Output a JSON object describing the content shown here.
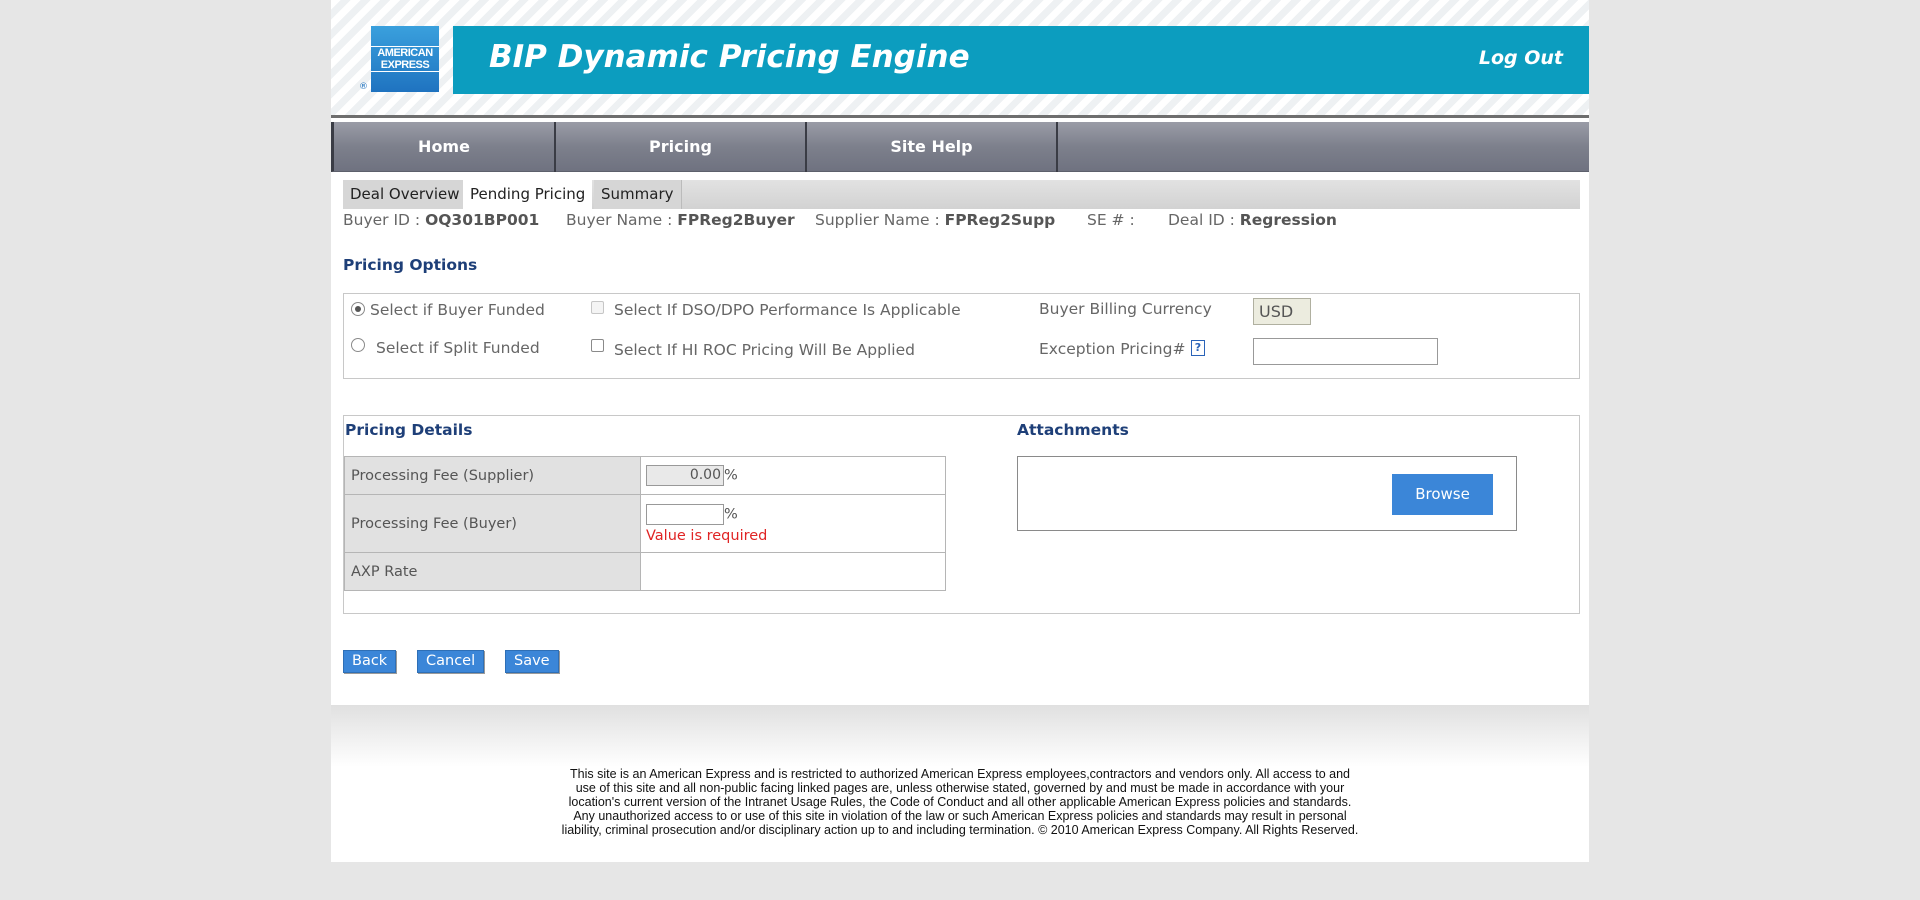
{
  "header": {
    "logo_text": "AMERICAN EXPRESS",
    "logo_reg": "®",
    "app_title": "BIP Dynamic Pricing Engine",
    "logout_label": "Log Out"
  },
  "nav": {
    "items": [
      "Home",
      "Pricing",
      "Site Help"
    ]
  },
  "tabs": [
    "Deal Overview",
    "Pending Pricing",
    "Summary"
  ],
  "active_tab": "Pending Pricing",
  "info": {
    "buyer_id_label": "Buyer ID :",
    "buyer_id": "OQ301BP001",
    "buyer_name_label": "Buyer Name :",
    "buyer_name": "FPReg2Buyer",
    "supplier_name_label": "Supplier Name :",
    "supplier_name": "FPReg2Supp",
    "se_label": "SE # :",
    "se_value": "",
    "deal_id_label": "Deal ID :",
    "deal_id": "Regression"
  },
  "pricing_options": {
    "title": "Pricing Options",
    "buyer_funded_label": "Select if Buyer Funded",
    "split_funded_label": "Select if Split Funded",
    "dso_label": "Select If DSO/DPO Performance Is Applicable",
    "hi_roc_label": "Select If HI ROC Pricing Will Be Applied",
    "currency_label": "Buyer Billing Currency",
    "currency_value": "USD",
    "exception_label": "Exception Pricing#",
    "exception_value": "",
    "help_icon": "?"
  },
  "pricing_details": {
    "title": "Pricing Details",
    "rows": [
      {
        "label": "Processing Fee (Supplier)",
        "value": "0.00",
        "unit": "%"
      },
      {
        "label": "Processing Fee (Buyer)",
        "value": "",
        "unit": "%",
        "error": "Value is required"
      },
      {
        "label": "AXP Rate",
        "value": ""
      }
    ]
  },
  "attachments": {
    "title": "Attachments",
    "browse_label": "Browse"
  },
  "buttons": {
    "back": "Back",
    "cancel": "Cancel",
    "save": "Save"
  },
  "footer": {
    "lines": [
      "This site is an American Express and is restricted to authorized American Express employees,contractors and vendors only. All access to and",
      "use of this site and all non-public facing linked pages are, unless otherwise stated, governed by and must be made in accordance with your",
      "location's current version of the Intranet Usage Rules, the Code of Conduct and all other applicable American Express policies and standards.",
      "Any unauthorized access to or use of this site in violation of the law or such American Express policies and standards may result in personal",
      "liability, criminal prosecution and/or disciplinary action up to and including termination. © 2010 American Express Company. All Rights Reserved."
    ]
  },
  "colors": {
    "banner": "#0c9dbf",
    "nav": "#7d808c",
    "button": "#3b86d8",
    "section_title": "#1e3f78",
    "error": "#e02424"
  }
}
